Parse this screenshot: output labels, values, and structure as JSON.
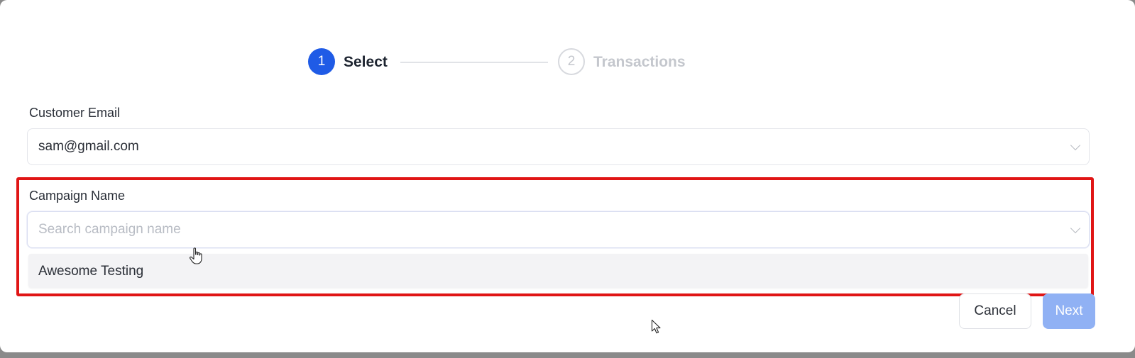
{
  "stepper": {
    "steps": [
      {
        "number": "1",
        "label": "Select"
      },
      {
        "number": "2",
        "label": "Transactions"
      }
    ]
  },
  "customer_email": {
    "label": "Customer Email",
    "value": "sam@gmail.com"
  },
  "campaign": {
    "label": "Campaign Name",
    "placeholder": "Search campaign name",
    "options": [
      "Awesome Testing"
    ]
  },
  "buttons": {
    "cancel": "Cancel",
    "next": "Next"
  },
  "colors": {
    "primary": "#1f5be6",
    "next_disabled": "#90b1f4",
    "highlight": "#e01515"
  },
  "icons": [
    "chevron-down-icon",
    "hand-pointer-icon",
    "arrow-cursor-icon"
  ]
}
